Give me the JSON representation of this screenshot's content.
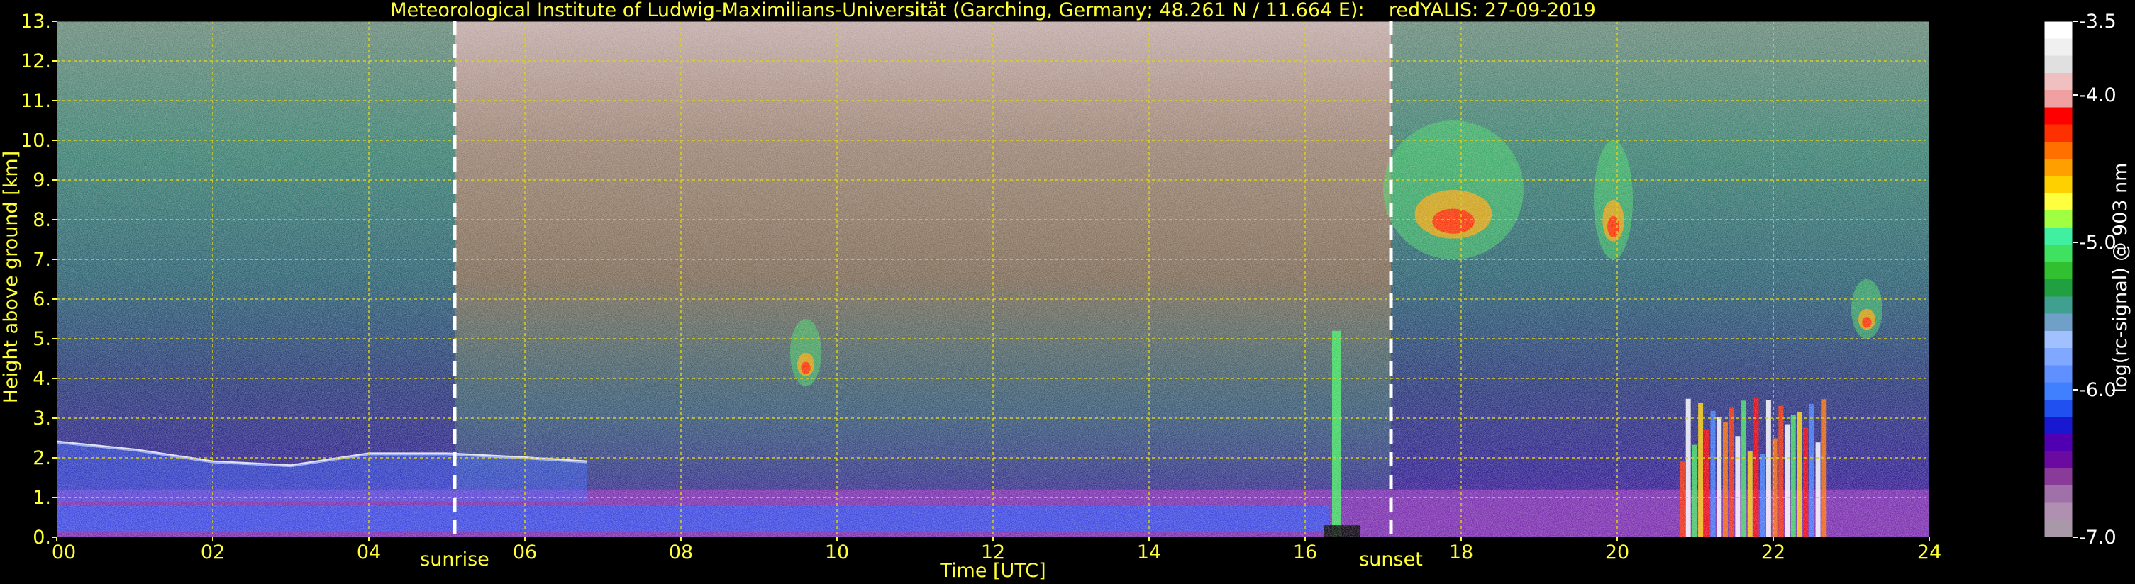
{
  "chart_data": {
    "type": "heatmap",
    "title": "Meteorological Institute of Ludwig-Maximilians-Universität (Garching, Germany; 48.261 N / 11.664 E):    redYALIS: 27-09-2019",
    "xlabel": "Time [UTC]",
    "ylabel": "Height above ground [km]",
    "xlim": [
      0,
      24
    ],
    "ylim": [
      0,
      13
    ],
    "x_ticks": [
      "00",
      "02",
      "04",
      "06",
      "08",
      "10",
      "12",
      "14",
      "16",
      "18",
      "20",
      "22",
      "24"
    ],
    "y_ticks": [
      "0.",
      "1.",
      "2.",
      "3.",
      "4.",
      "5.",
      "6.",
      "7.",
      "8.",
      "9.",
      "10.",
      "11.",
      "12.",
      "13."
    ],
    "grid": true,
    "annotations": [
      {
        "text": "sunrise",
        "x": 5.1
      },
      {
        "text": "sunset",
        "x": 17.1
      }
    ],
    "colorbar": {
      "label": "log(rc-signal) @ 903 nm",
      "range": [
        -7.0,
        -3.5
      ],
      "ticks": [
        "-3.5",
        "-4.0",
        "-5.0",
        "-6.0",
        "-7.0"
      ],
      "tick_values": [
        -3.5,
        -4.0,
        -5.0,
        -6.0,
        -7.0
      ],
      "colors": [
        "#a898a8",
        "#b090b0",
        "#a070a8",
        "#8a3a98",
        "#6a0aa0",
        "#5000b0",
        "#1818d0",
        "#2050f0",
        "#4080ff",
        "#6090ff",
        "#80a8ff",
        "#a0c0ff",
        "#70a0c8",
        "#40a090",
        "#20a040",
        "#30c030",
        "#40e060",
        "#40f0a0",
        "#a0ff40",
        "#ffff40",
        "#ffd000",
        "#ffa000",
        "#ff7000",
        "#ff3000",
        "#ff0000",
        "#f0a0a0",
        "#f0c0c0",
        "#e0e0e0",
        "#f0f0f0",
        "#ffffff"
      ]
    },
    "features": [
      {
        "type": "boundary_layer",
        "desc": "dense signal layer near ground",
        "t_range": [
          0,
          24
        ],
        "h_max_km": 1.2
      },
      {
        "type": "aerosol_layer_top",
        "t": [
          0,
          1,
          2,
          3,
          4,
          5,
          6,
          6.8
        ],
        "h": [
          2.4,
          2.2,
          1.9,
          1.8,
          2.1,
          2.1,
          2.0,
          1.9
        ]
      },
      {
        "type": "cloud_plume",
        "t_center": 9.6,
        "h_range": [
          3.8,
          5.5
        ]
      },
      {
        "type": "cirrus",
        "t_range": [
          17.0,
          18.8
        ],
        "h_range": [
          7.0,
          10.5
        ]
      },
      {
        "type": "cirrus",
        "t_range": [
          19.7,
          20.2
        ],
        "h_range": [
          7.0,
          10.0
        ]
      },
      {
        "type": "cloud_small",
        "t_center": 23.2,
        "h_range": [
          5.0,
          6.5
        ]
      },
      {
        "type": "precip_streaks",
        "t_range": [
          20.8,
          22.7
        ],
        "h_range": [
          0,
          3.5
        ]
      },
      {
        "type": "virga",
        "t_center": 16.4,
        "h_range": [
          0,
          5.2
        ]
      }
    ]
  }
}
